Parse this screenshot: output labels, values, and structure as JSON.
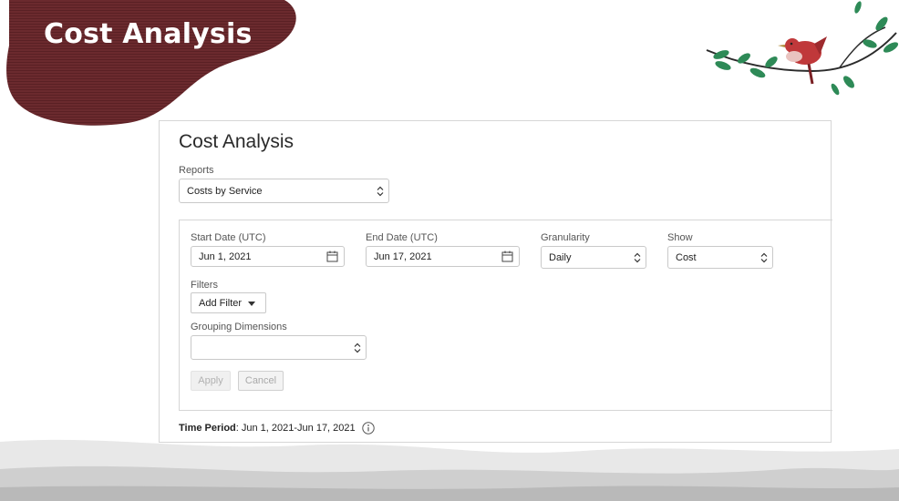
{
  "slide": {
    "title": "Cost Analysis"
  },
  "panel": {
    "title": "Cost Analysis",
    "reports": {
      "label": "Reports",
      "value": "Costs by Service"
    },
    "start_date": {
      "label": "Start Date (UTC)",
      "value": "Jun 1, 2021"
    },
    "end_date": {
      "label": "End Date (UTC)",
      "value": "Jun 17, 2021"
    },
    "granularity": {
      "label": "Granularity",
      "value": "Daily"
    },
    "show": {
      "label": "Show",
      "value": "Cost"
    },
    "filters": {
      "label": "Filters",
      "add_filter": "Add Filter"
    },
    "grouping": {
      "label": "Grouping Dimensions",
      "value": ""
    },
    "buttons": {
      "apply": "Apply",
      "cancel": "Cancel"
    },
    "time_period": {
      "label": "Time Period",
      "value": ": Jun 1, 2021-Jun 17, 2021"
    }
  },
  "colors": {
    "title_blob": "#6b2a2e",
    "bird": "#c0383a",
    "leaves": "#2e8a57"
  },
  "icons": [
    "calendar-icon",
    "chevron-updown-icon",
    "caret-down-icon",
    "info-icon"
  ]
}
